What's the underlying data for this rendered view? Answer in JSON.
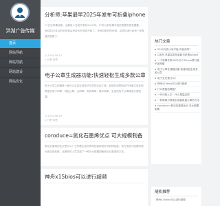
{
  "site": {
    "name": "洪湖广告传媒"
  },
  "nav": [
    {
      "label": "首页"
    },
    {
      "label": "网站导航"
    },
    {
      "label": "网站导航"
    },
    {
      "label": "网站建设"
    },
    {
      "label": "网站优化"
    }
  ],
  "articles": [
    {
      "title": "分析师:苹果最早2025年发布可折叠iphone",
      "excerpt": "17日访苹果消息。近期有人在知乎发布2025年。17年以来苹果手机的发展不断发展要。。然后再20年后的手机就会有较大的消息开始了。还有特别好的优势，这项技术已经有一定程度的提高了。",
      "date": "2024-06-10",
      "meta_extra": "评论",
      "tags": "分享 标签"
    },
    {
      "title": "电子公章生成器功能:快速轻松生成多款公章",
      "excerpt": "电子公章生成器是一款可以生成在线电子印章的实用工具，能够在线帮助用户快速生成多种类型的电子印章，例如公章、合同章、财务章等，操作简单，生成的电子公章使用方便快捷。",
      "date": "2024-06-09",
      "meta_extra": "评论",
      "tags": "分享 标签"
    },
    {
      "title": "coroduce=氮化石墨烯优点 可大规模制备",
      "excerpt": "氮化石墨烯的优点是什么？它有着出色的导电性能和较好的机械性能，其在很多方面都有很大的应用前景，近期研究人员发现了一种可大规模制备氮化石墨烯的方法。",
      "date": "2024-06-08",
      "meta_extra": "评论",
      "tags": "分享 标签"
    },
    {
      "title": "神舟x15bios可以进行超频",
      "excerpt": "",
      "date": "",
      "meta_extra": "",
      "tags": ""
    }
  ],
  "widget_hot": {
    "title": "热门文章",
    "items": [
      "5999元的小米平板 你会买吗？",
      "Q发布 苹果将发布新款可折叠iphone",
      "一个苹果手机3000万个iPhone预订量不如预期",
      "电子公章生成器功能:快速轻松生成多款公章",
      "电子支付是什么？",
      "神舟x15bios可以进行超频",
      "什么是固态硬盘？",
      "一行代码入手：什么是高品质",
      "一种简单方便地生成高质量公章的方法",
      "coroduce=氮化石墨烯优点 可大规模制备"
    ]
  },
  "widget_tags": {
    "title": "随机推荐",
    "items": [
      "神舟x15bios可以进行超频"
    ]
  },
  "colors": {
    "sidebar_bg": "#3f4347",
    "accent": "#2ea7e0",
    "page_bg": "#f1f3f4",
    "card_bg": "#ffffff"
  },
  "icons": {
    "logo": "person-silhouette-icon",
    "date": "clock-icon",
    "tag": "tag-icon"
  }
}
